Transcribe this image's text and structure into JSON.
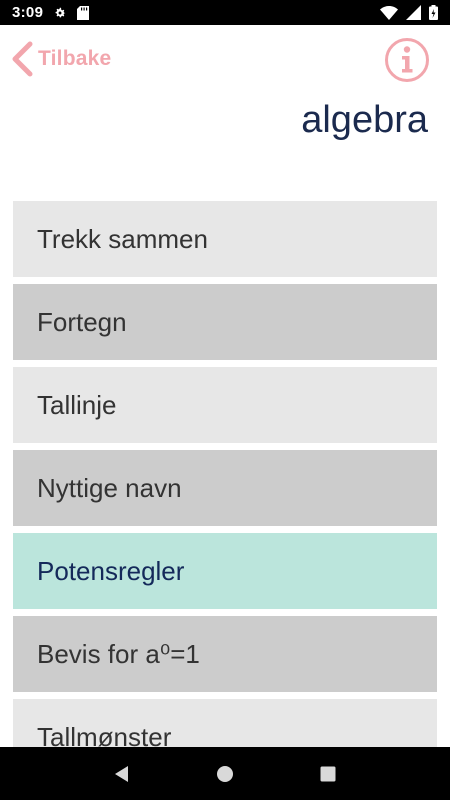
{
  "status_bar": {
    "time": "3:09",
    "icons": [
      "gear-icon",
      "sd-card-icon",
      "wifi-icon",
      "signal-icon",
      "battery-icon"
    ]
  },
  "header": {
    "back_label": "Tilbake",
    "info_icon": "info-icon",
    "title": "algebra"
  },
  "colors": {
    "accent": "#f2a6ad",
    "title": "#1b2a4e",
    "item_light": "#e7e7e7",
    "item_dark": "#cccccc",
    "item_active": "#bbe5dc"
  },
  "topics": [
    {
      "label": "Trekk sammen"
    },
    {
      "label": "Fortegn"
    },
    {
      "label": "Tallinje"
    },
    {
      "label": "Nyttige navn"
    },
    {
      "label": "Potensregler"
    },
    {
      "label": "Bevis for a⁰=1"
    },
    {
      "label": "Tallmønster"
    }
  ],
  "nav_bar": {
    "icons": [
      "back-triangle-icon",
      "home-circle-icon",
      "recents-square-icon"
    ]
  }
}
